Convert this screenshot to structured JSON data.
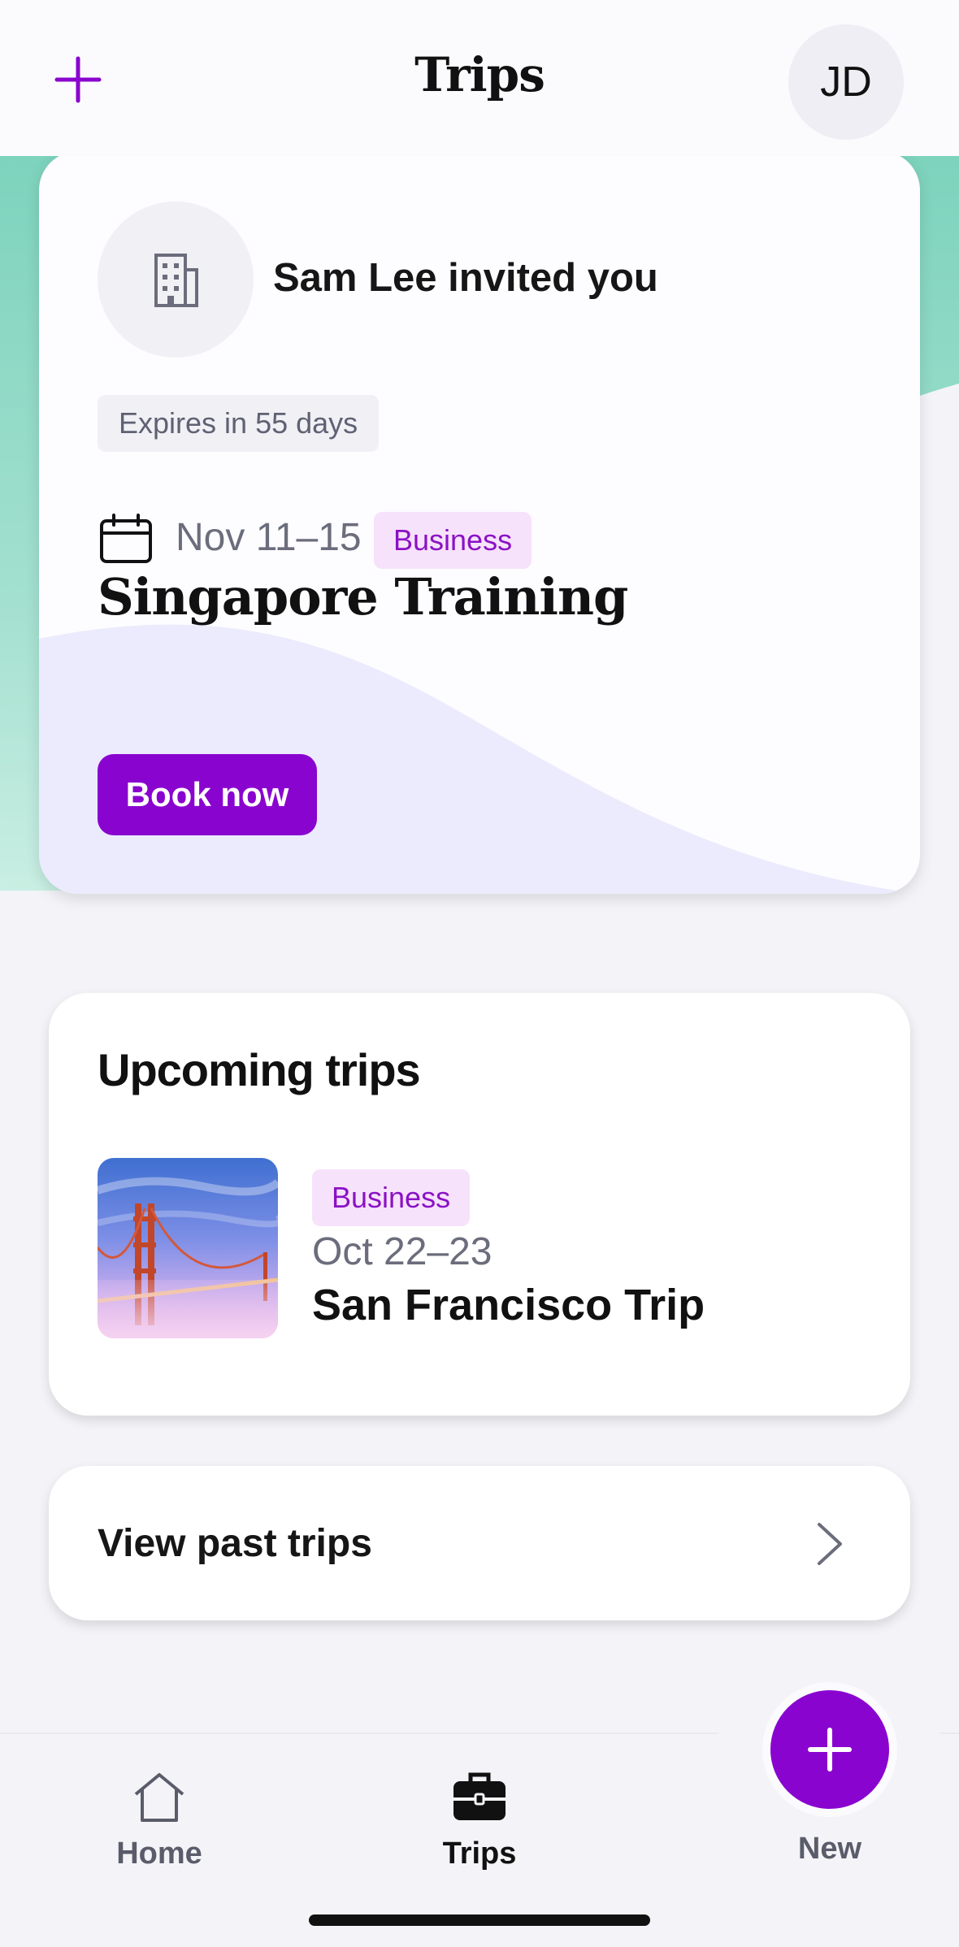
{
  "header": {
    "title": "Trips",
    "add_icon": "plus-icon",
    "avatar_initials": "JD"
  },
  "invite": {
    "org_icon": "building-icon",
    "message": "Sam Lee invited you",
    "expires": "Expires in 55 days",
    "calendar_icon": "calendar-icon",
    "dates": "Nov 11–15",
    "purpose": "Business",
    "title": "Singapore Training",
    "book_label": "Book now"
  },
  "upcoming": {
    "section_title": "Upcoming trips",
    "trips": [
      {
        "image": "golden-gate-bridge-photo",
        "purpose": "Business",
        "dates": "Oct 22–23",
        "title": "San Francisco Trip"
      }
    ]
  },
  "past_trips": {
    "label": "View past trips",
    "chevron_icon": "chevron-right-icon"
  },
  "nav": {
    "items": [
      {
        "label": "Home",
        "icon": "home-icon",
        "active": false
      },
      {
        "label": "Trips",
        "icon": "briefcase-icon",
        "active": true
      }
    ],
    "new_label": "New",
    "fab_icon": "plus-icon"
  },
  "colors": {
    "accent": "#8a04cf",
    "chip_bg": "#f7e2fb",
    "chip_text": "#8a12c4",
    "hero_green": "#7dd3bd",
    "wave_lavender": "#ebebfd",
    "background": "#f4f4f8"
  }
}
